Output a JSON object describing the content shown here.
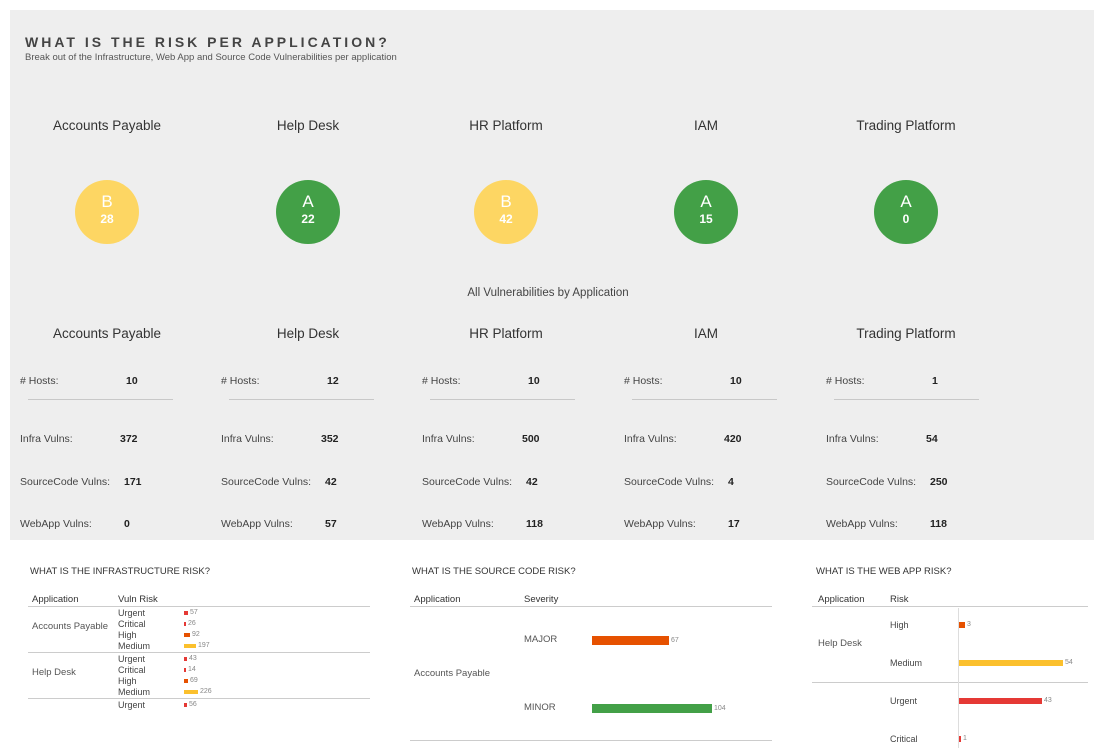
{
  "header": {
    "title": "WHAT IS THE RISK PER APPLICATION?",
    "subtitle": "Break out of the Infrastructure, Web App and Source Code Vulnerabilities per application"
  },
  "grades": [
    {
      "app": "Accounts Payable",
      "grade": "B",
      "score": "28"
    },
    {
      "app": "Help Desk",
      "grade": "A",
      "score": "22"
    },
    {
      "app": "HR Platform",
      "grade": "B",
      "score": "42"
    },
    {
      "app": "IAM",
      "grade": "A",
      "score": "15"
    },
    {
      "app": "Trading Platform",
      "grade": "A",
      "score": "0"
    }
  ],
  "vulns_label": "All Vulnerabilities by Application",
  "labels": {
    "hosts": "# Hosts:",
    "infra": "Infra Vulns:",
    "source": "SourceCode Vulns:",
    "webapp": "WebApp Vulns:"
  },
  "vulns": [
    {
      "app": "Accounts Payable",
      "hosts": "10",
      "infra": "372",
      "source": "171",
      "webapp": "0"
    },
    {
      "app": "Help Desk",
      "hosts": "12",
      "infra": "352",
      "source": "42",
      "webapp": "57"
    },
    {
      "app": "HR Platform",
      "hosts": "10",
      "infra": "500",
      "source": "42",
      "webapp": "118"
    },
    {
      "app": "IAM",
      "hosts": "10",
      "infra": "420",
      "source": "4",
      "webapp": "17"
    },
    {
      "app": "Trading Platform",
      "hosts": "1",
      "infra": "54",
      "source": "250",
      "webapp": "118"
    }
  ],
  "infra_panel": {
    "title": "WHAT IS THE INFRASTRUCTURE RISK?",
    "col_app": "Application",
    "col_risk": "Vuln Risk",
    "groups": [
      {
        "app": "Accounts Payable",
        "rows": [
          {
            "risk": "Urgent",
            "value": "57"
          },
          {
            "risk": "Critical",
            "value": "26"
          },
          {
            "risk": "High",
            "value": "92"
          },
          {
            "risk": "Medium",
            "value": "197"
          }
        ]
      },
      {
        "app": "Help Desk",
        "rows": [
          {
            "risk": "Urgent",
            "value": "43"
          },
          {
            "risk": "Critical",
            "value": "14"
          },
          {
            "risk": "High",
            "value": "69"
          },
          {
            "risk": "Medium",
            "value": "226"
          }
        ]
      },
      {
        "app": "",
        "rows": [
          {
            "risk": "Urgent",
            "value": "56"
          }
        ]
      }
    ]
  },
  "source_panel": {
    "title": "WHAT IS THE SOURCE CODE RISK?",
    "col_app": "Application",
    "col_sev": "Severity",
    "app": "Accounts Payable",
    "rows": [
      {
        "sev": "MAJOR",
        "value": 67,
        "color": "#e65100"
      },
      {
        "sev": "MINOR",
        "value": 104,
        "color": "#43a047"
      }
    ]
  },
  "web_panel": {
    "title": "WHAT IS THE WEB APP RISK?",
    "col_app": "Application",
    "col_risk": "Risk",
    "app": "Help Desk",
    "rows": [
      {
        "risk": "High",
        "value": 3,
        "color": "#e65100"
      },
      {
        "risk": "Medium",
        "value": 54,
        "color": "#fbc02d"
      },
      {
        "risk": "Urgent",
        "value": 43,
        "color": "#e53935"
      },
      {
        "risk": "Critical",
        "value": 1,
        "color": "#e53935"
      }
    ]
  },
  "colors": {
    "grade_A": "#43a047",
    "grade_B": "#fdd663",
    "urgent": "#e53935",
    "high": "#e65100",
    "medium": "#fbc02d"
  }
}
